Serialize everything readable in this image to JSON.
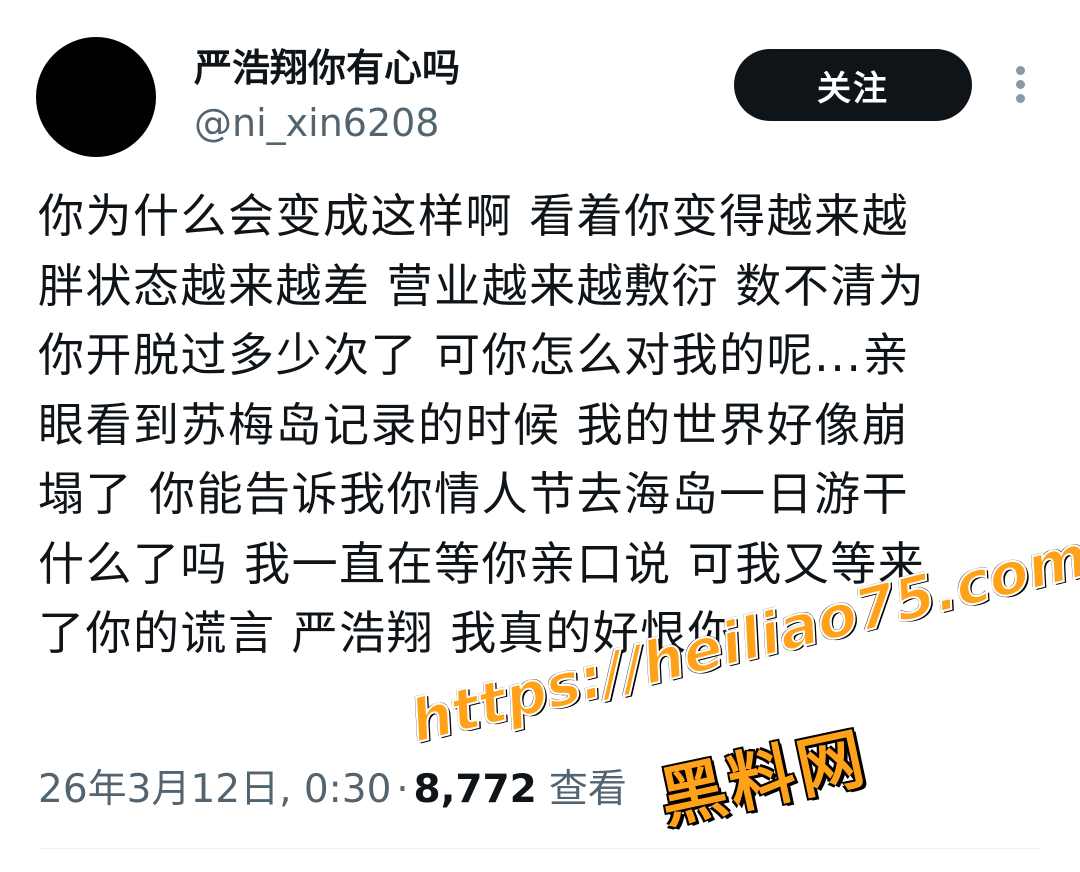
{
  "author": {
    "display_name": "严浩翔你有心吗",
    "handle": "@ni_xin6208"
  },
  "header": {
    "follow_label": "关注"
  },
  "tweet": {
    "text": "你为什么会变成这样啊 看着你变得越来越\n胖状态越来越差 营业越来越敷衍 数不清为\n你开脱过多少次了 可你怎么对我的呢...亲\n眼看到苏梅岛记录的时候 我的世界好像崩\n塌了 你能告诉我你情人节去海岛一日游干\n什么了吗 我一直在等你亲口说 可我又等来\n了你的谎言 严浩翔 我真的好恨你"
  },
  "meta": {
    "timestamp": "26年3月12日, 0:30",
    "separator": "·",
    "views_count": "8,772",
    "views_label": "查看"
  },
  "watermark": {
    "url": "https://heiliao75.com",
    "brand": "黑料网",
    "color": "#ffa21a"
  },
  "colors": {
    "text_primary": "#0f1419",
    "text_secondary": "#536471",
    "follow_button_bg": "#0f1419",
    "follow_button_text": "#ffffff"
  }
}
